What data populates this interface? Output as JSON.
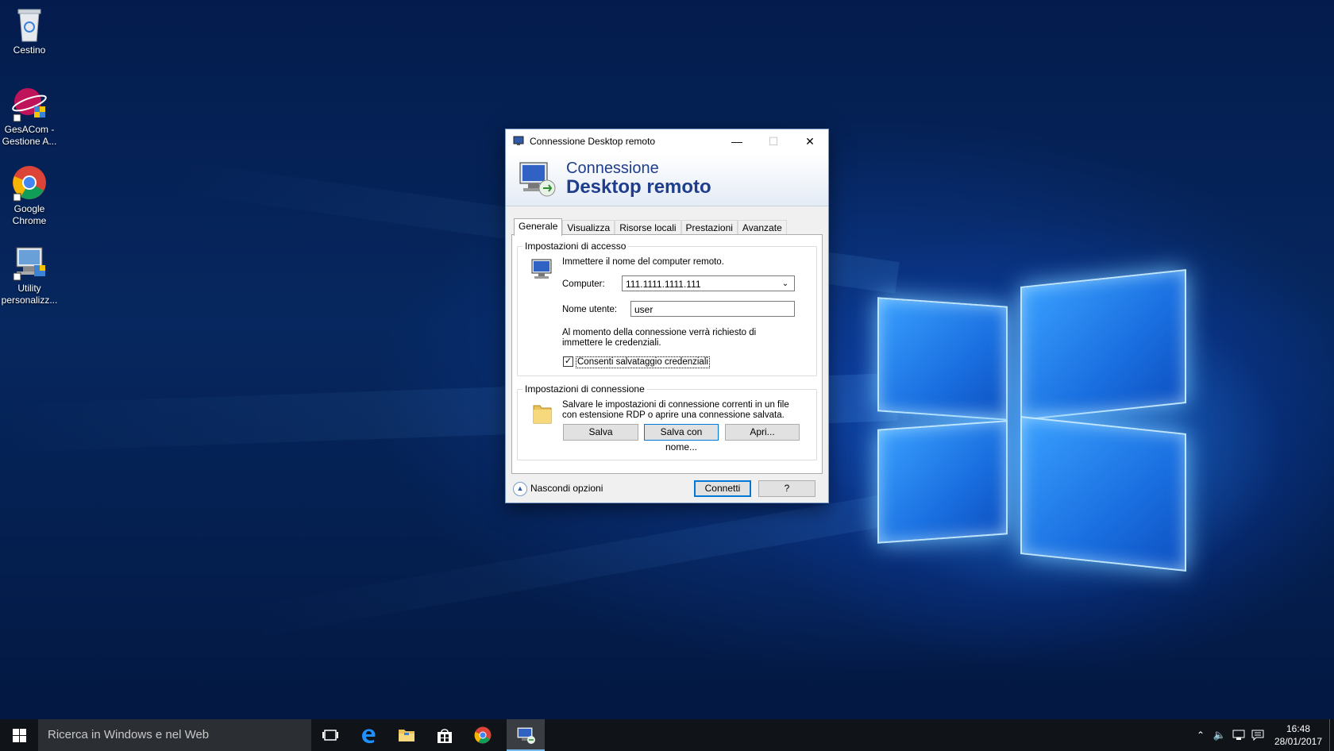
{
  "desktop": {
    "icons": [
      {
        "label": "Cestino",
        "icon": "recycle-bin-icon"
      },
      {
        "label": "GesACom - Gestione A...",
        "icon": "gesacom-app-icon"
      },
      {
        "label": "Google Chrome",
        "icon": "chrome-icon"
      },
      {
        "label": "Utility personalizz...",
        "icon": "utility-app-icon"
      }
    ]
  },
  "dialog": {
    "title": "Connessione Desktop remoto",
    "banner_line1": "Connessione",
    "banner_line2": "Desktop remoto",
    "tabs": [
      "Generale",
      "Visualizza",
      "Risorse locali",
      "Prestazioni",
      "Avanzate"
    ],
    "active_tab": "Generale",
    "access": {
      "group_title": "Impostazioni di accesso",
      "instruction": "Immettere il nome del computer remoto.",
      "computer_label": "Computer:",
      "computer_value": "111.1111.1111.111",
      "user_label": "Nome utente:",
      "user_value": "user",
      "note": "Al momento della connessione verrà richiesto di immettere le credenziali.",
      "save_credentials_label": "Consenti salvataggio credenziali",
      "save_credentials_checked": true
    },
    "connection": {
      "group_title": "Impostazioni di connessione",
      "description": "Salvare le impostazioni di connessione correnti in un file con estensione RDP o aprire una connessione salvata.",
      "save_label": "Salva",
      "save_as_label": "Salva con nome...",
      "open_label": "Apri..."
    },
    "hide_options_label": "Nascondi opzioni",
    "connect_label": "Connetti",
    "help_label": "?"
  },
  "taskbar": {
    "search_placeholder": "Ricerca in Windows e nel Web",
    "time": "16:48",
    "date": "28/01/2017"
  }
}
